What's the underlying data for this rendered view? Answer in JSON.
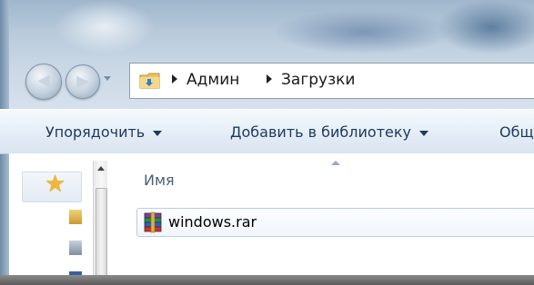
{
  "navigation": {
    "back_glyph": "◀",
    "forward_glyph": "▶"
  },
  "address_bar": {
    "crumbs": [
      "Админ",
      "Загрузки"
    ]
  },
  "toolbar": {
    "organize_label": "Упорядочить",
    "add_to_library_label": "Добавить в библиотеку",
    "share_label": "Общ"
  },
  "nav_pane": {
    "favorites_icon": "star-icon"
  },
  "content": {
    "column_name": "Имя",
    "files": [
      {
        "name": "windows.rar",
        "icon": "winrar-archive-icon"
      }
    ]
  },
  "colors": {
    "toolbar_text": "#1e395b",
    "selection_border": "#b9cde2",
    "star": "#f2b632"
  }
}
